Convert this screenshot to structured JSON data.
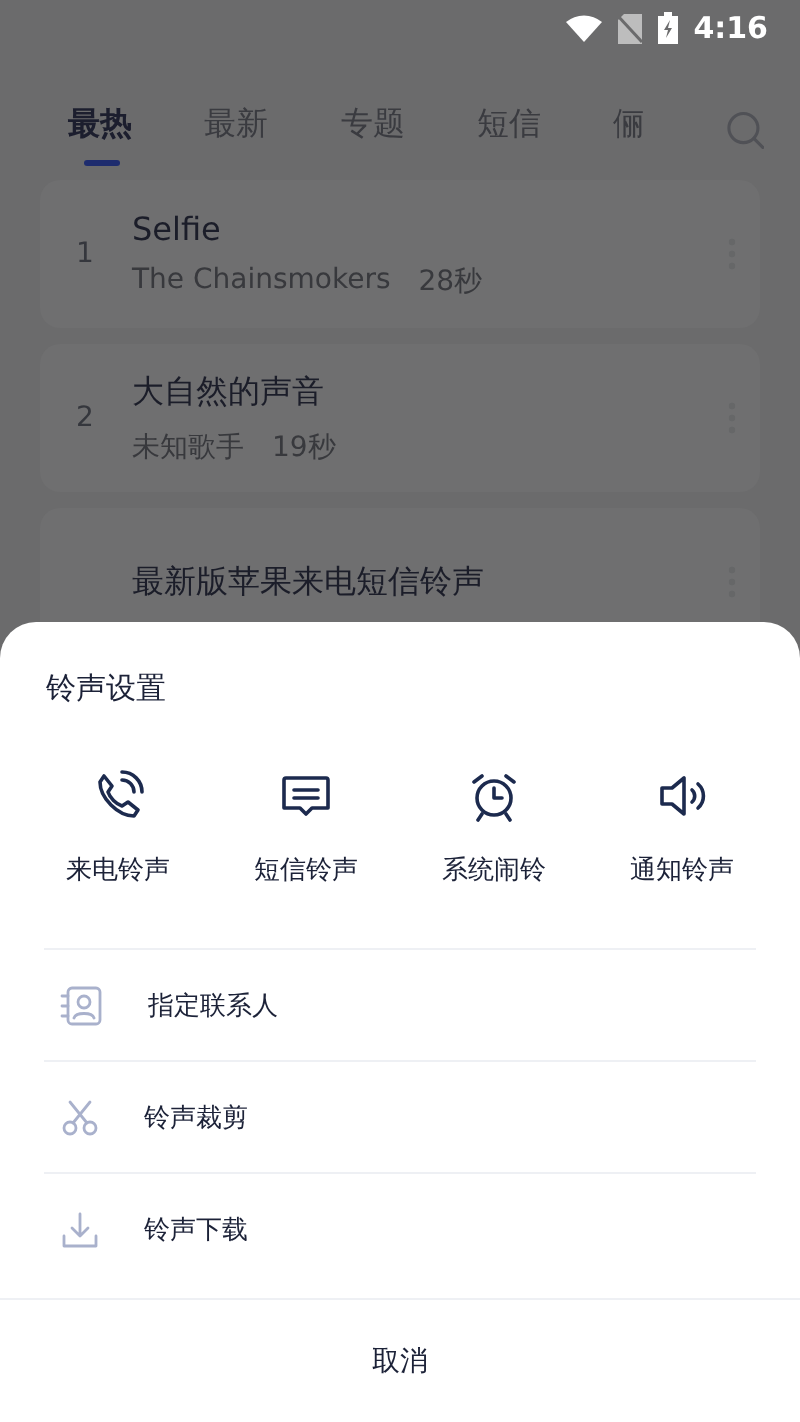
{
  "status_bar": {
    "time": "4:16"
  },
  "tabs": [
    {
      "label": "最热",
      "selected": true
    },
    {
      "label": "最新",
      "selected": false
    },
    {
      "label": "专题",
      "selected": false
    },
    {
      "label": "短信",
      "selected": false
    },
    {
      "label": "俪",
      "selected": false
    }
  ],
  "songs": [
    {
      "rank": "1",
      "title": "Selfie",
      "artist": "The Chainsmokers",
      "duration": "28秒"
    },
    {
      "rank": "2",
      "title": "大自然的声音",
      "artist": "未知歌手",
      "duration": "19秒"
    },
    {
      "title": "最新版苹果来电短信铃声"
    }
  ],
  "sheet": {
    "title": "铃声设置",
    "actions": [
      {
        "kind": "phone",
        "label": "来电铃声"
      },
      {
        "kind": "message",
        "label": "短信铃声"
      },
      {
        "kind": "alarm",
        "label": "系统闹铃"
      },
      {
        "kind": "speaker",
        "label": "通知铃声"
      }
    ],
    "options": [
      {
        "kind": "contact",
        "label": "指定联系人"
      },
      {
        "kind": "scissors",
        "label": "铃声裁剪"
      },
      {
        "kind": "download",
        "label": "铃声下载"
      }
    ],
    "cancel": "取消"
  }
}
